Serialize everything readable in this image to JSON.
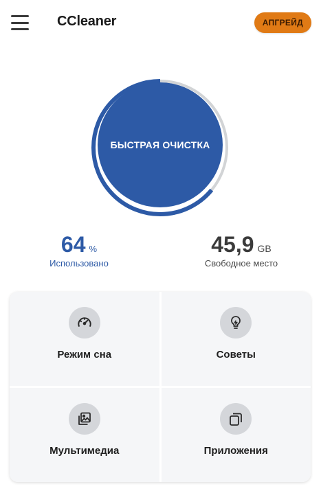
{
  "header": {
    "title": "CCleaner",
    "upgrade_label": "АПГРЕЙД"
  },
  "gauge": {
    "button_label": "БЫСТРАЯ ОЧИСТКА",
    "used_fraction": 0.64
  },
  "stats": {
    "used": {
      "value": "64",
      "unit": "%",
      "label": "Использовано"
    },
    "free": {
      "value": "45,9",
      "unit": "GB",
      "label": "Свободное место"
    }
  },
  "tiles": [
    {
      "label": "Режим сна",
      "icon": "speedometer-icon"
    },
    {
      "label": "Советы",
      "icon": "lightbulb-icon"
    },
    {
      "label": "Мультимедиа",
      "icon": "media-icon"
    },
    {
      "label": "Приложения",
      "icon": "apps-icon"
    }
  ],
  "colors": {
    "accent": "#2d5aa6",
    "upgrade": "#e07a15",
    "track": "#d2d4d6"
  }
}
